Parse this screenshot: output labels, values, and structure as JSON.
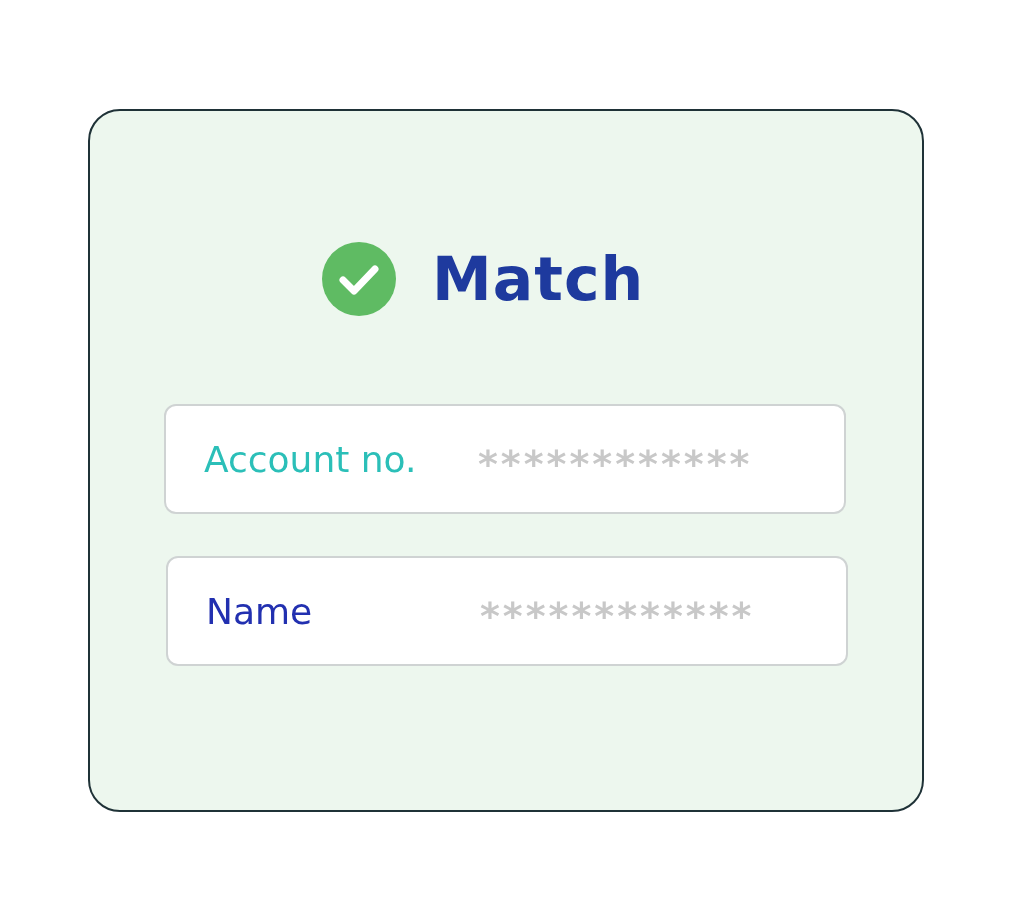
{
  "status": {
    "kind": "match",
    "title": "Match"
  },
  "fields": [
    {
      "label": "Account no.",
      "value": "************",
      "color": "#2bbfb8"
    },
    {
      "label": "Name",
      "value": "************",
      "color": "#2230b0"
    }
  ]
}
